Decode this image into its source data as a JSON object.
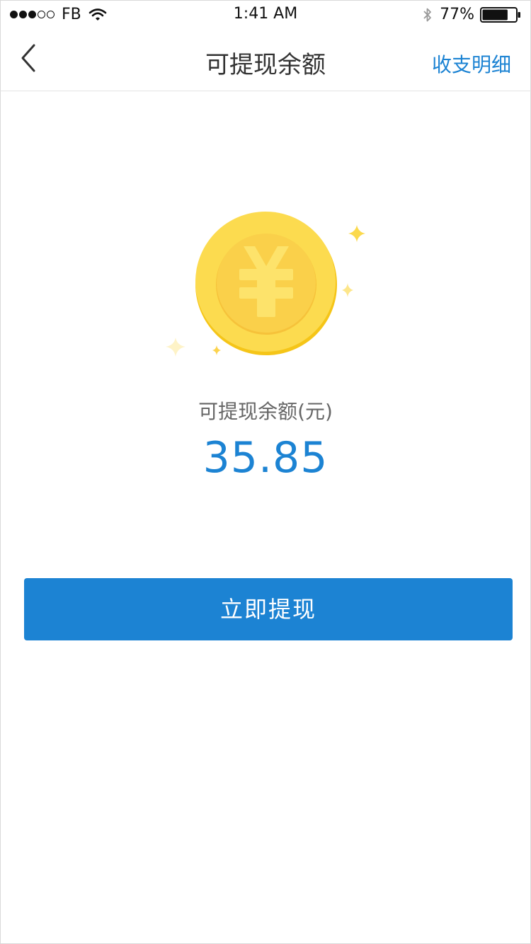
{
  "status_bar": {
    "carrier": "FB",
    "time": "1:41 AM",
    "battery_percent": "77%",
    "battery_level": 0.77,
    "signal_bars_filled": 3,
    "signal_bars_total": 5
  },
  "navbar": {
    "title": "可提现余额",
    "action_label": "收支明细",
    "back_icon": "chevron-left-icon"
  },
  "balance": {
    "label": "可提现余额(元)",
    "amount": "35.85"
  },
  "withdraw_button": {
    "label": "立即提现"
  },
  "colors": {
    "accent": "#1c83d3",
    "coin_outer": "#fbd94d",
    "coin_inner": "#f8c83a",
    "yen_symbol": "#fde36b"
  }
}
